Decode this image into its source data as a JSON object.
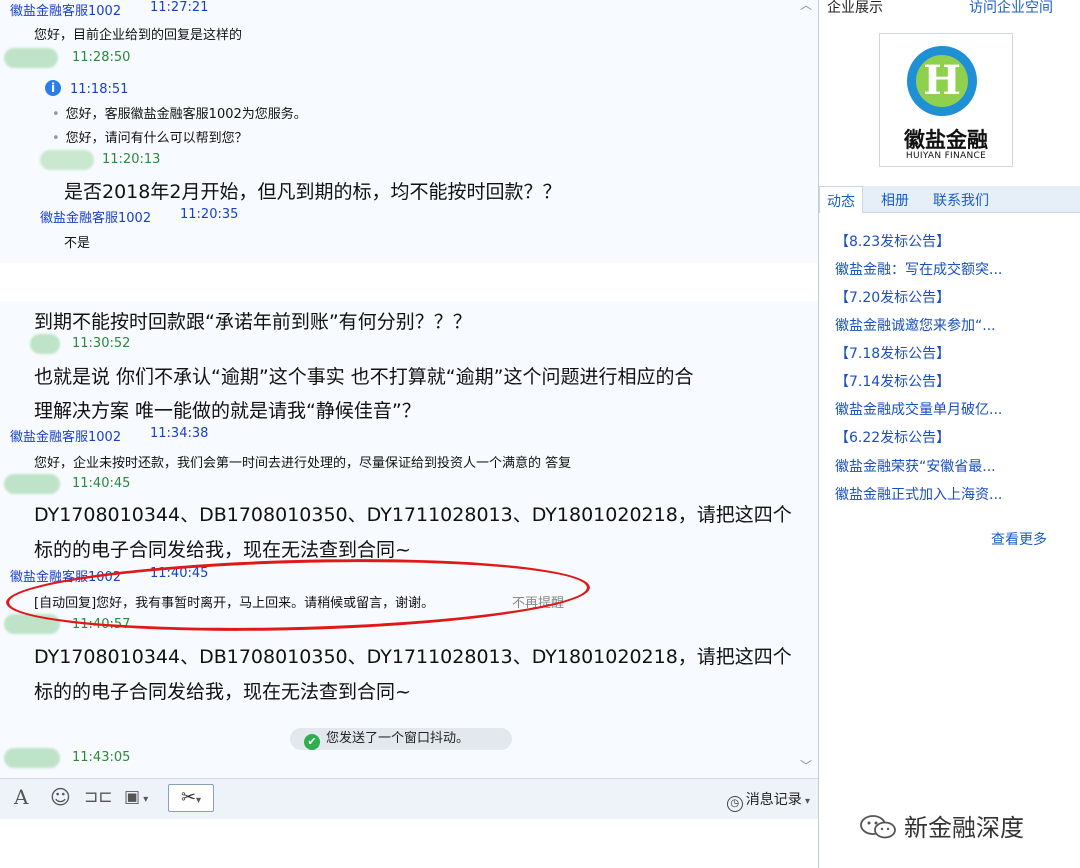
{
  "chat": {
    "messages": [
      {
        "sender": "徽盐金融客服1002",
        "time": "11:27:21"
      },
      {
        "text": "您好，目前企业给到的回复是这样的"
      },
      {
        "time": "11:28:50"
      },
      {
        "time": "11:18:51"
      },
      {
        "text": "您好，客服徽盐金融客服1002为您服务。"
      },
      {
        "text": "您好，请问有什么可以帮到您？"
      },
      {
        "time": "11:20:13"
      },
      {
        "text": "是否2018年2月开始，但凡到期的标，均不能按时回款？？"
      },
      {
        "sender": "徽盐金融客服1002",
        "time": "11:20:35"
      },
      {
        "text": "不是"
      },
      {
        "text": "到期不能按时回款跟“承诺年前到账”有何分别？？？"
      },
      {
        "time": "11:30:52"
      },
      {
        "text": "也就是说 你们不承认“逾期”这个事实 也不打算就“逾期”这个问题进行相应的合"
      },
      {
        "text": "理解决方案 唯一能做的就是请我“静候佳音”？"
      },
      {
        "sender": "徽盐金融客服1002",
        "time": "11:34:38"
      },
      {
        "text": "您好，企业未按时还款，我们会第一时间去进行处理的，尽量保证给到投资人一个满意的 答复"
      },
      {
        "time": "11:40:45"
      },
      {
        "text": "DY1708010344、DB1708010350、DY1711028013、DY1801020218，请把这四个"
      },
      {
        "text": "标的的电子合同发给我，现在无法查到合同~"
      },
      {
        "sender": "徽盐金融客服1002",
        "time": "11:40:45"
      },
      {
        "text": "[自动回复]您好，我有事暂时离开，马上回来。请稍候或留言，谢谢。",
        "action": "不再提醒"
      },
      {
        "time": "11:40:57"
      },
      {
        "text": "DY1708010344、DB1708010350、DY1711028013、DY1801020218，请把这四个"
      },
      {
        "text": "标的的电子合同发给我，现在无法查到合同~"
      },
      {
        "text": "您发送了一个窗口抖动。"
      },
      {
        "time": "11:43:05"
      }
    ]
  },
  "toolbar": {
    "font_icon": "A",
    "history_label": "消息记录"
  },
  "sidebar": {
    "header_left": "企业展示",
    "header_right": "访问企业空间",
    "logo_letter": "H",
    "logo_cn": "徽盐金融",
    "logo_en": "HUIYAN FINANCE",
    "tabs": [
      "动态",
      "相册",
      "联系我们"
    ],
    "news": [
      "【8.23发标公告】",
      "徽盐金融：写在成交额突...",
      "【7.20发标公告】",
      "徽盐金融诚邀您来参加“...",
      "【7.18发标公告】",
      "【7.14发标公告】",
      "徽盐金融成交量单月破亿...",
      "【6.22发标公告】",
      "徽盐金融荣获“安徽省最...",
      "徽盐金融正式加入上海资..."
    ],
    "more_label": "查看更多"
  },
  "watermark": "新金融深度",
  "colors": {
    "accent": "#1a3fc7",
    "highlight": "#e01818",
    "time_green": "#2a8a3a"
  }
}
